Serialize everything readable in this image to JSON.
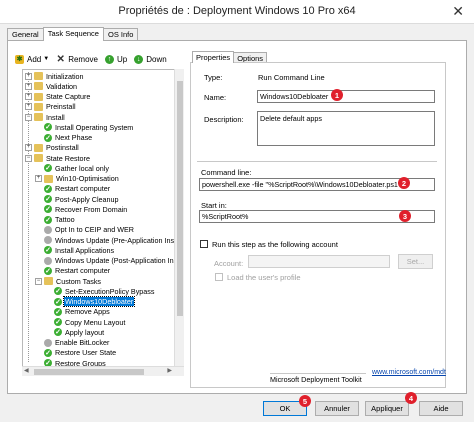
{
  "window": {
    "title": "Propriétés de : Deployment Windows 10 Pro x64",
    "close_glyph": "✕"
  },
  "tabs": [
    "General",
    "Task Sequence",
    "OS Info"
  ],
  "toolbar": {
    "add": "Add",
    "remove": "Remove",
    "up": "Up",
    "down": "Down"
  },
  "tree": {
    "items": [
      {
        "label": "Initialization",
        "icon": "folder",
        "expander": "+"
      },
      {
        "label": "Validation",
        "icon": "folder",
        "expander": "+"
      },
      {
        "label": "State Capture",
        "icon": "folder",
        "expander": "+"
      },
      {
        "label": "Preinstall",
        "icon": "folder",
        "expander": "+"
      },
      {
        "label": "Install",
        "icon": "folder",
        "expander": "−"
      },
      {
        "label": "Install Operating System",
        "icon": "check"
      },
      {
        "label": "Next Phase",
        "icon": "check"
      },
      {
        "label": "Postinstall",
        "icon": "folder",
        "expander": "+"
      },
      {
        "label": "State Restore",
        "icon": "folder",
        "expander": "−"
      },
      {
        "label": "Gather local only",
        "icon": "check"
      },
      {
        "label": "Win10-Optimisation",
        "icon": "folder",
        "expander": "+"
      },
      {
        "label": "Restart computer",
        "icon": "check"
      },
      {
        "label": "Post-Apply Cleanup",
        "icon": "check"
      },
      {
        "label": "Recover From Domain",
        "icon": "check"
      },
      {
        "label": "Tattoo",
        "icon": "check"
      },
      {
        "label": "Opt In to CEIP and WER",
        "icon": "gray"
      },
      {
        "label": "Windows Update (Pre-Application Inst",
        "icon": "gray"
      },
      {
        "label": "Install Applications",
        "icon": "check"
      },
      {
        "label": "Windows Update (Post-Application Insta",
        "icon": "gray"
      },
      {
        "label": "Restart computer",
        "icon": "check"
      },
      {
        "label": "Custom Tasks",
        "icon": "folder",
        "expander": "−"
      },
      {
        "label": "Set-ExecutionPolicy Bypass",
        "icon": "check"
      },
      {
        "label": "Windows10Debloater",
        "icon": "check",
        "selected": true
      },
      {
        "label": "Remove Apps",
        "icon": "check"
      },
      {
        "label": "Copy Menu Layout",
        "icon": "check"
      },
      {
        "label": "Apply layout",
        "icon": "check"
      },
      {
        "label": "Enable BitLocker",
        "icon": "gray"
      },
      {
        "label": "Restore User State",
        "icon": "check"
      },
      {
        "label": "Restore Groups",
        "icon": "check"
      }
    ]
  },
  "props": {
    "tabs": [
      "Properties",
      "Options"
    ],
    "type_label": "Type:",
    "type_value": "Run Command Line",
    "name_label": "Name:",
    "name_value": "Windows10Debloater",
    "desc_label": "Description:",
    "desc_value": "Delete default apps",
    "cmd_label": "Command line:",
    "cmd_value": "powershell.exe -file \"%ScriptRoot%\\Windows10Debloater.ps1\"",
    "start_label": "Start in:",
    "start_value": "%ScriptRoot%",
    "run_as_label": "Run this step as the following account",
    "account_label": "Account:",
    "set_label": "Set...",
    "load_profile_label": "Load the user's profile",
    "brand": "Microsoft Deployment Toolkit",
    "link": "www.microsoft.com/mdt"
  },
  "buttons": {
    "ok": "OK",
    "cancel": "Annuler",
    "apply": "Appliquer",
    "help": "Aide"
  },
  "badges": [
    "1",
    "2",
    "3",
    "4",
    "5"
  ],
  "colors": {
    "badge": "#e0202c",
    "selection": "#0078d7",
    "check": "#3cae33",
    "folder": "#e5c25a"
  }
}
